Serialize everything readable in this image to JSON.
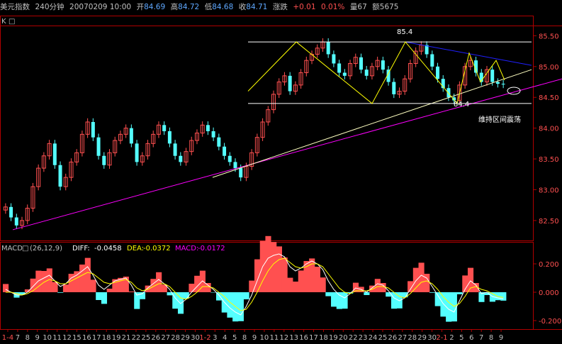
{
  "header": {
    "title": "美元指数",
    "period": "240分钟",
    "date_time": "20070209 10:00",
    "open_label": "开",
    "open_value": "84.69",
    "high_label": "高",
    "high_value": "84.72",
    "low_label": "低",
    "low_value": "84.68",
    "close_label": "收",
    "close_value": "84.71",
    "change_label": "涨跌",
    "change_value": "+0.01",
    "change_pct": "0.01%",
    "volume_label": "量",
    "volume_value": "67",
    "amount_label": "额",
    "amount_value": "5675"
  },
  "main_panel": {
    "k_label": "K",
    "k_box": "□",
    "high_annotation": "85.4",
    "low_annotation": "84.4",
    "note": "维持区间震荡"
  },
  "macd_panel": {
    "label": "MACD",
    "box": "□",
    "params": "(26,12,9)",
    "diff_label": "DIFF:",
    "diff_value": "-0.0458",
    "dea_label": "DEA:",
    "dea_value": "-0.0372",
    "macd_label": "MACD:",
    "macd_value": "-0.0172"
  },
  "colors": {
    "up": "#ff5050",
    "down": "#54ffff",
    "diff_line": "#ffffff",
    "dea_line": "#ffff00",
    "macd_text": "#ff00ff",
    "trend_magenta": "#ff00ff",
    "trend_blue": "#2020ff",
    "trend_white": "#ffffff",
    "zigzag_yellow": "#ffff00",
    "panel_border": "#b00000"
  },
  "chart_data": [
    {
      "type": "candlestick",
      "y_axis_ticks": [
        "85.50",
        "85.00",
        "84.50",
        "84.00",
        "83.50",
        "83.00",
        "82.50"
      ],
      "ylim": [
        62.28,
        85.62
      ],
      "note": "82.28 lower bound approximated",
      "x_tick_labels": [
        "1-4",
        "7",
        "8",
        "9",
        "10",
        "11",
        "12",
        "15",
        "16",
        "17",
        "18",
        "19",
        "21",
        "22",
        "25",
        "26",
        "27",
        "28",
        "29",
        "30",
        "1-2",
        "3",
        "4",
        "5",
        "8",
        "9",
        "10",
        "11",
        "12",
        "13",
        "16",
        "17",
        "18",
        "19",
        "20",
        "22",
        "23",
        "24",
        "25",
        "26",
        "27",
        "28",
        "29",
        "30",
        "2-1",
        "2",
        "5",
        "6",
        "7",
        "8",
        "9"
      ],
      "close": [
        82.72,
        82.55,
        82.42,
        82.5,
        82.7,
        83.05,
        83.35,
        83.55,
        83.75,
        83.4,
        83.05,
        83.2,
        83.45,
        83.6,
        83.9,
        84.1,
        83.85,
        83.55,
        83.4,
        83.6,
        83.8,
        83.9,
        84.0,
        83.75,
        83.45,
        83.55,
        83.75,
        83.9,
        84.05,
        83.95,
        83.75,
        83.55,
        83.45,
        83.62,
        83.8,
        83.92,
        84.05,
        83.95,
        83.85,
        83.7,
        83.55,
        83.45,
        83.35,
        83.2,
        83.38,
        83.6,
        83.85,
        84.1,
        84.3,
        84.55,
        84.75,
        84.85,
        84.6,
        84.7,
        84.9,
        85.1,
        85.2,
        85.3,
        85.4,
        85.2,
        85.05,
        84.9,
        84.85,
        85.05,
        85.15,
        84.95,
        84.85,
        85.0,
        85.1,
        84.95,
        84.75,
        84.55,
        84.6,
        84.8,
        85.05,
        85.25,
        85.35,
        85.2,
        85.0,
        84.8,
        84.65,
        84.5,
        84.45,
        84.7,
        85.0,
        85.1,
        84.9,
        84.75,
        84.95,
        84.75,
        84.72,
        84.71
      ],
      "diff": [
        0.02,
        0.0,
        -0.02,
        -0.02,
        0.0,
        0.04,
        0.08,
        0.1,
        0.12,
        0.08,
        0.04,
        0.06,
        0.1,
        0.12,
        0.15,
        0.18,
        0.12,
        0.05,
        0.02,
        0.05,
        0.08,
        0.09,
        0.1,
        0.05,
        -0.02,
        -0.01,
        0.03,
        0.06,
        0.09,
        0.06,
        0.02,
        -0.04,
        -0.08,
        -0.05,
        0.0,
        0.04,
        0.08,
        0.05,
        0.02,
        -0.02,
        -0.07,
        -0.11,
        -0.14,
        -0.16,
        -0.1,
        -0.02,
        0.08,
        0.18,
        0.24,
        0.26,
        0.27,
        0.25,
        0.18,
        0.15,
        0.17,
        0.2,
        0.22,
        0.2,
        0.16,
        0.08,
        0.02,
        -0.02,
        -0.04,
        -0.01,
        0.03,
        0.02,
        0.0,
        0.03,
        0.06,
        0.05,
        0.01,
        -0.04,
        -0.06,
        -0.04,
        0.02,
        0.08,
        0.12,
        0.1,
        0.04,
        -0.02,
        -0.08,
        -0.12,
        -0.14,
        -0.06,
        0.02,
        0.08,
        0.05,
        -0.01,
        0.0,
        -0.03,
        -0.04,
        -0.046
      ],
      "dea": [
        0.0,
        0.0,
        -0.01,
        -0.02,
        -0.01,
        0.01,
        0.04,
        0.07,
        0.09,
        0.08,
        0.06,
        0.06,
        0.08,
        0.1,
        0.12,
        0.14,
        0.13,
        0.1,
        0.07,
        0.06,
        0.07,
        0.08,
        0.09,
        0.07,
        0.03,
        0.01,
        0.02,
        0.04,
        0.06,
        0.06,
        0.04,
        0.0,
        -0.04,
        -0.05,
        -0.03,
        0.0,
        0.04,
        0.04,
        0.03,
        0.0,
        -0.03,
        -0.07,
        -0.1,
        -0.13,
        -0.12,
        -0.07,
        0.0,
        0.08,
        0.15,
        0.2,
        0.23,
        0.24,
        0.21,
        0.18,
        0.17,
        0.18,
        0.2,
        0.2,
        0.18,
        0.13,
        0.08,
        0.03,
        0.0,
        -0.01,
        0.01,
        0.01,
        0.01,
        0.02,
        0.04,
        0.04,
        0.03,
        0.0,
        -0.03,
        -0.04,
        -0.01,
        0.03,
        0.07,
        0.08,
        0.06,
        0.02,
        -0.03,
        -0.07,
        -0.1,
        -0.08,
        -0.03,
        0.03,
        0.04,
        0.02,
        0.01,
        -0.01,
        -0.03,
        -0.037
      ],
      "macd_ylim": [
        -0.24,
        0.26
      ],
      "macd_ticks": [
        "0.200",
        "0.000",
        "-0.200"
      ]
    }
  ]
}
